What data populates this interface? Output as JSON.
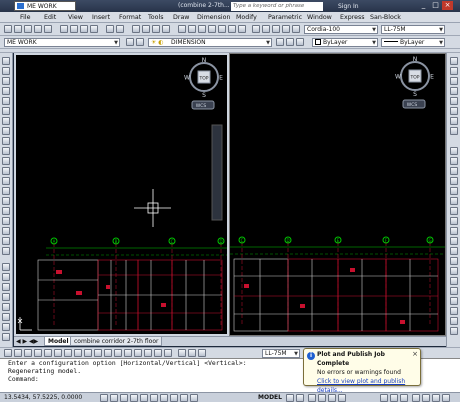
{
  "title_bar": {
    "workspace": "ME WORK",
    "document_title": "(combine 2-7th...",
    "search_placeholder": "Type a keyword or phrase",
    "sign_in": "Sign In"
  },
  "menu": [
    "File",
    "Edit",
    "View",
    "Insert",
    "Format",
    "Tools",
    "Draw",
    "Dimension",
    "Modify",
    "Parametric",
    "Window",
    "Express",
    "San-Block"
  ],
  "toolbar": {
    "text_style": "Cordia-100",
    "annotation_scale": "LL-75M",
    "workspace_combo": "ME WORK",
    "dim_style": "DIMENSION",
    "color_combo": "ByLayer",
    "linetype_combo": "ByLayer"
  },
  "viewcube": {
    "top": "TOP",
    "north": "N",
    "south": "S",
    "east": "E",
    "west": "W",
    "wcs": "WCS"
  },
  "tabs": [
    "Model",
    "combine corridor 2-7th floor"
  ],
  "layout_tag": "LL-75M",
  "command_lines": [
    "Enter a configuration option [Horizontal/Vertical] <Vertical>:",
    "Regenerating model.",
    "Command:"
  ],
  "status": {
    "coords": "13.5434, 57.5225, 0.0000",
    "model": "MODEL"
  },
  "notification": {
    "title": "Plot and Publish Job Complete",
    "message": "No errors or warnings found",
    "link": "Click to view plot and publish details..."
  },
  "grid_labels": [
    "A",
    "B",
    "C",
    "D",
    "E",
    "F",
    "G"
  ],
  "colors": {
    "viewport_bg": "#000000",
    "grid_line": "#c8102e",
    "grid_bubble": "#00c800",
    "crosshair": "#ffffff",
    "accent": "#1f5fd0"
  }
}
